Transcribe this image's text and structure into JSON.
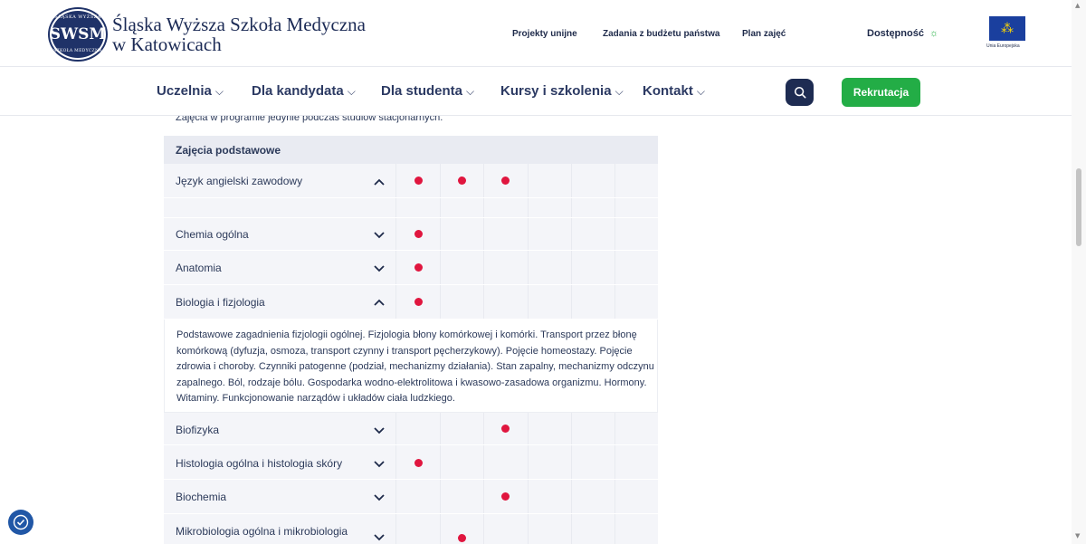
{
  "header": {
    "logo_abbr": "SWSM",
    "logo_ring_top": "ŚLĄSKA WYŻSZA",
    "logo_ring_bottom": "SZKOŁA MEDYCZNA",
    "school_name_line1": "Śląska Wyższa Szkoła Medyczna",
    "school_name_line2": "w Katowicach",
    "top_links": [
      "Projekty unijne",
      "Zadania z budżetu państwa",
      "Plan zajęć"
    ],
    "accessibility_label": "Dostępność",
    "eu_caption": "Unia Europejska"
  },
  "nav": {
    "items": [
      "Uczelnia",
      "Dla kandydata",
      "Dla studenta",
      "Kursy i szkolenia",
      "Kontakt"
    ],
    "cta_label": "Rekrutacja"
  },
  "content": {
    "note": "Zajęcia w programie jedynie podczas studiów stacjonarnych.",
    "section_title": "Zajęcia podstawowe",
    "rows": [
      {
        "label": "Język angielski zawodowy",
        "expanded": true,
        "dots": [
          1,
          2,
          3
        ]
      },
      {
        "label": "Chemia ogólna",
        "expanded": false,
        "dots": [
          1
        ]
      },
      {
        "label": "Anatomia",
        "expanded": false,
        "dots": [
          1
        ]
      },
      {
        "label": "Biologia i fizjologia",
        "expanded": true,
        "dots": [
          1
        ]
      },
      {
        "label": "Biofizyka",
        "expanded": false,
        "dots": [
          3
        ]
      },
      {
        "label": "Histologia ogólna i histologia skóry",
        "expanded": false,
        "dots": [
          1
        ]
      },
      {
        "label": "Biochemia",
        "expanded": false,
        "dots": [
          3
        ]
      },
      {
        "label": "Mikrobiologia ogólna i mikrobiologia",
        "expanded": false,
        "dots": [
          2
        ]
      }
    ],
    "description": "Podstawowe zagadnienia fizjologii ogólnej. Fizjologia błony komórkowej i komórki. Transport przez błonę komórkową (dyfuzja, osmoza, transport czynny i transport pęcherzykowy). Pojęcie homeostazy. Pojęcie zdrowia i choroby. Czynniki patogenne (podział, mechanizmy działania). Stan zapalny, mechanizmy odczynu zapalnego. Ból, rodzaje bólu. Gospodarka wodno-elektrolitowa i kwasowo-zasadowa organizmu. Hormony. Witaminy. Funkcjonowanie narządów i układów ciała ludzkiego."
  },
  "colors": {
    "brand_navy": "#1f3268",
    "cta_green": "#23ad46",
    "dot_red": "#e0163f",
    "eu_blue": "#1a3f9e"
  },
  "icons": [
    "search-icon",
    "sun-icon",
    "chevron-down-icon",
    "chevron-up-icon",
    "accessibility-icon"
  ]
}
